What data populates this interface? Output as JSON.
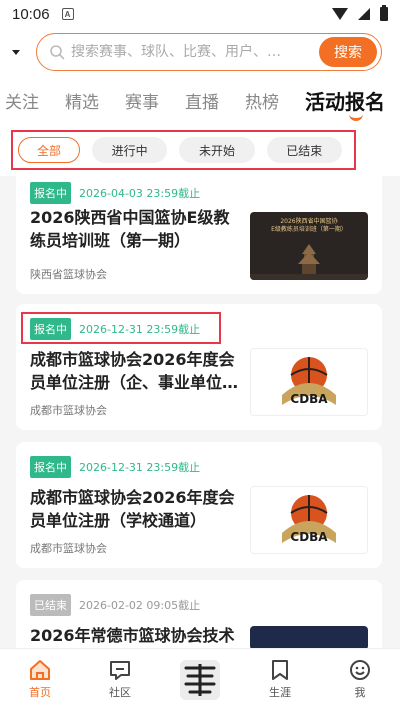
{
  "status": {
    "time": "10:06",
    "indicator": "A"
  },
  "search": {
    "placeholder": "搜索赛事、球队、比赛、用户、…",
    "button": "搜索"
  },
  "tabs": [
    {
      "label": "关注"
    },
    {
      "label": "精选"
    },
    {
      "label": "赛事"
    },
    {
      "label": "直播"
    },
    {
      "label": "热榜"
    },
    {
      "label": "活动报名"
    }
  ],
  "filters": [
    {
      "label": "全部"
    },
    {
      "label": "进行中"
    },
    {
      "label": "未开始"
    },
    {
      "label": "已结束"
    }
  ],
  "cards": [
    {
      "status": "报名中",
      "deadline": "2026-04-03 23:59截止",
      "title": "2026陕西省中国篮协E级教练员培训班（第一期）",
      "organizer": "陕西省篮球协会",
      "thumb_text": "2026陕西省中国篮协\nE级教练员培训班（第一期）"
    },
    {
      "status": "报名中",
      "deadline": "2026-12-31 23:59截止",
      "title": "成都市篮球协会2026年度会员单位注册（企、事业单位…",
      "organizer": "成都市篮球协会",
      "thumb_text": "CDBA"
    },
    {
      "status": "报名中",
      "deadline": "2026-12-31 23:59截止",
      "title": "成都市篮球协会2026年度会员单位注册（学校通道）",
      "organizer": "成都市篮球协会",
      "thumb_text": "CDBA"
    },
    {
      "status": "已结束",
      "deadline": "2026-02-02 09:05截止",
      "title": "2026年常德市篮球协会技术",
      "organizer": ""
    }
  ],
  "bottom_nav": [
    {
      "label": "首页",
      "icon": "home-icon"
    },
    {
      "label": "社区",
      "icon": "community-icon"
    },
    {
      "label": "",
      "icon": "center-logo-icon"
    },
    {
      "label": "生涯",
      "icon": "career-icon"
    },
    {
      "label": "我",
      "icon": "profile-icon"
    }
  ],
  "colors": {
    "accent": "#f26f24",
    "active_badge": "#2fb98a",
    "ended_badge": "#bbbbbb",
    "highlight": "#e8364a"
  }
}
